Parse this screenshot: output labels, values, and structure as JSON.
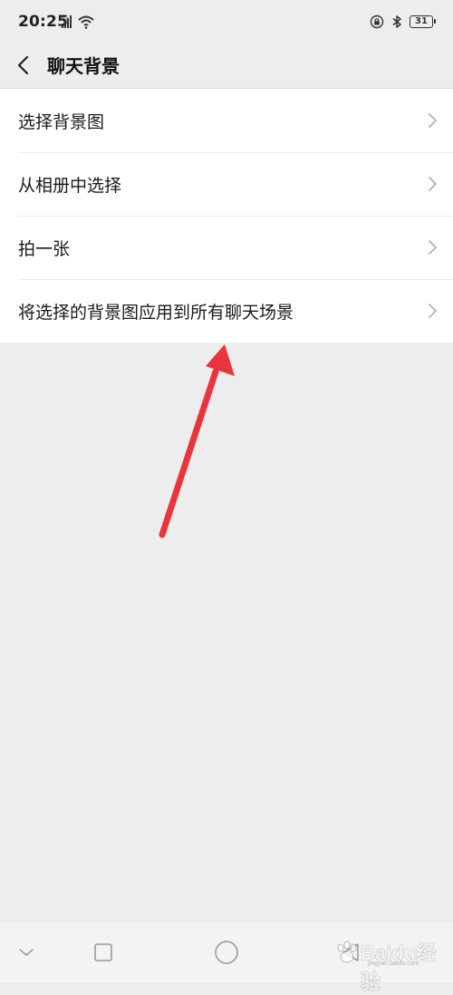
{
  "status_bar": {
    "time": "20:25",
    "network_label": "4G",
    "battery_level": "31",
    "icons": [
      "signal-icon",
      "wifi-icon",
      "lock-rotation-icon",
      "bluetooth-icon",
      "battery-icon"
    ]
  },
  "header": {
    "back_icon": "chevron-left-icon",
    "title": "聊天背景"
  },
  "settings": {
    "items": [
      {
        "label": "选择背景图"
      },
      {
        "label": "从相册中选择"
      },
      {
        "label": "拍一张"
      },
      {
        "label": "将选择的背景图应用到所有聊天场景"
      }
    ]
  },
  "nav_bar": {
    "icons": [
      "collapse-icon",
      "recent-apps-icon",
      "home-icon",
      "back-icon"
    ]
  },
  "annotation": {
    "color": "#e8343a"
  },
  "watermark": {
    "text": "Baidu经验",
    "sub": "jingyan.baidu.com"
  },
  "colors": {
    "background": "#ededed",
    "list_background": "#ffffff",
    "accent_arrow": "#e8343a"
  }
}
